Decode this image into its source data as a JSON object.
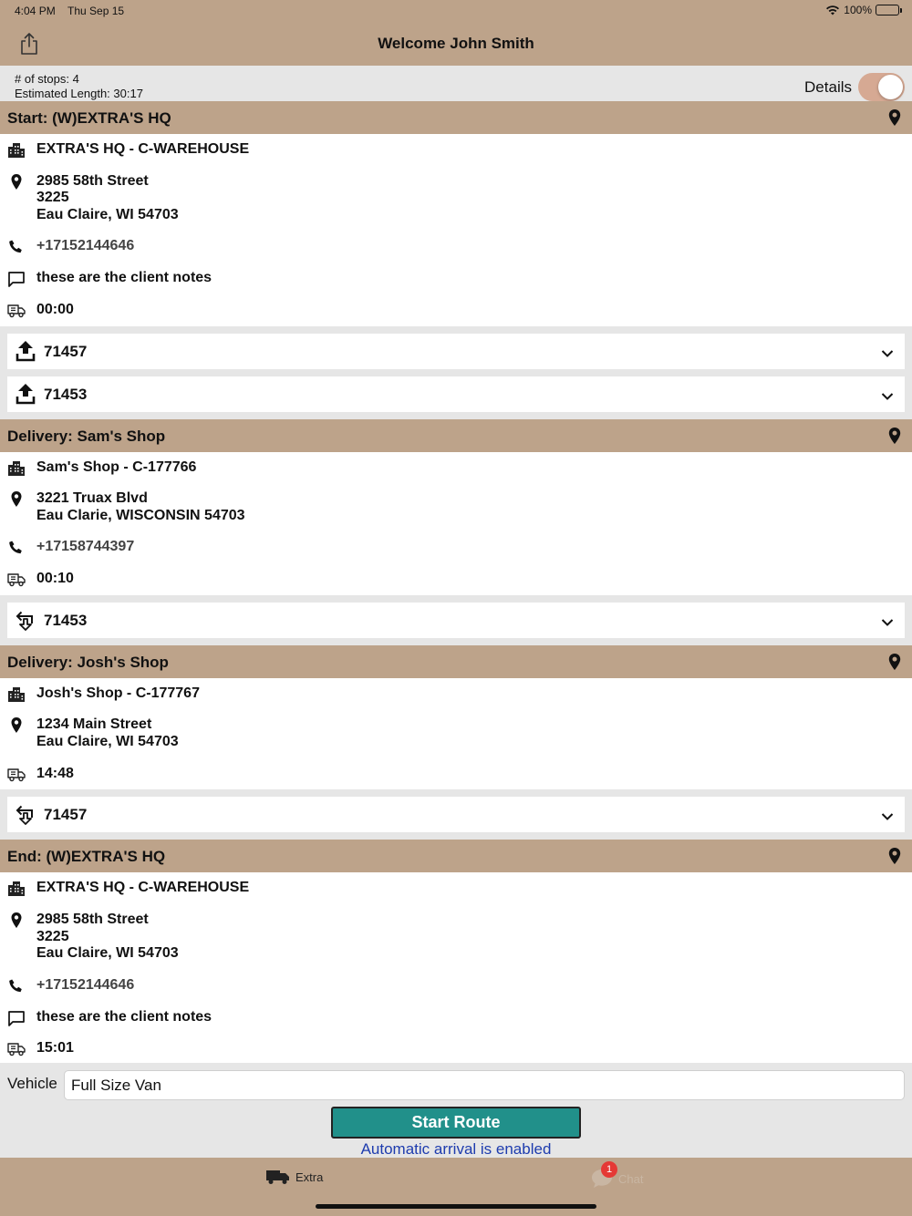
{
  "status": {
    "time": "4:04 PM",
    "date": "Thu Sep 15",
    "battery": "100%"
  },
  "header": {
    "title": "Welcome John Smith"
  },
  "summary": {
    "stops": "# of stops: 4",
    "length": "Estimated Length: 30:17",
    "details_label": "Details",
    "details_on": true
  },
  "stops": [
    {
      "header": "Start: (W)EXTRA'S HQ",
      "location": "EXTRA'S HQ - C-WAREHOUSE",
      "address": [
        "2985 58th Street",
        "3225",
        "Eau Claire, WI 54703"
      ],
      "phone": "+17152144646",
      "notes": "these are the client notes",
      "time": "00:00",
      "orders": [
        {
          "type": "pickup",
          "number": "71457"
        },
        {
          "type": "pickup",
          "number": "71453"
        }
      ]
    },
    {
      "header": "Delivery: Sam's Shop",
      "location": "Sam's Shop - C-177766",
      "address": [
        "3221 Truax Blvd",
        "Eau Clarie, WISCONSIN 54703"
      ],
      "phone": "+17158744397",
      "time": "00:10",
      "orders": [
        {
          "type": "delivery",
          "number": "71453"
        }
      ]
    },
    {
      "header": "Delivery: Josh's Shop",
      "location": "Josh's Shop - C-177767",
      "address": [
        "1234 Main Street",
        "Eau Claire, WI 54703"
      ],
      "time": "14:48",
      "orders": [
        {
          "type": "delivery",
          "number": "71457"
        }
      ]
    },
    {
      "header": "End: (W)EXTRA'S HQ",
      "location": "EXTRA'S HQ - C-WAREHOUSE",
      "address": [
        "2985 58th Street",
        "3225",
        "Eau Claire, WI 54703"
      ],
      "phone": "+17152144646",
      "notes": "these are the client notes",
      "time": "15:01"
    }
  ],
  "vehicle": {
    "label": "Vehicle",
    "value": "Full Size Van"
  },
  "actions": {
    "start_route": "Start Route",
    "auto_arrival": "Automatic arrival is enabled"
  },
  "tabs": [
    {
      "label": "Extra",
      "icon": "truck-icon"
    },
    {
      "label": "Chat",
      "icon": "chat-bubble-icon",
      "badge": "1"
    }
  ],
  "colors": {
    "header_bg": "#bda38a",
    "accent": "#21908a",
    "link": "#1e3cae",
    "badge": "#e53935",
    "toggle": "#d6a993"
  }
}
